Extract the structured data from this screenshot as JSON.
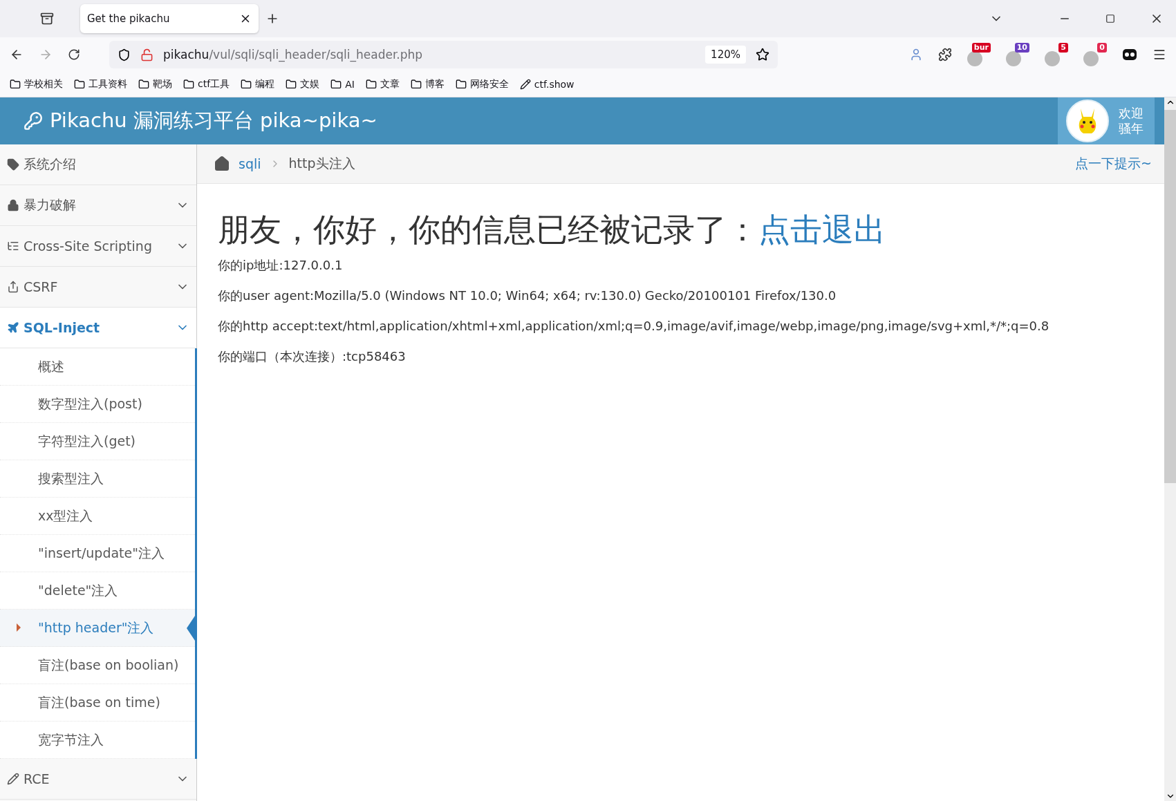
{
  "browser": {
    "tabs": [
      {
        "title": "Get the pikachu",
        "selected": true
      }
    ],
    "url": {
      "host": "pikachu",
      "path": "/vul/sqli/sqli_header/sqli_header.php"
    },
    "zoom": "120%",
    "extensions": [
      {
        "kind": "avatar"
      },
      {
        "kind": "puzzle"
      },
      {
        "kind": "badge",
        "badge": "bur",
        "color": "#d70022"
      },
      {
        "kind": "badge",
        "badge": "10",
        "color": "#6a3fc0"
      },
      {
        "kind": "badge",
        "badge": "5",
        "color": "#d70022"
      },
      {
        "kind": "badge",
        "badge": "0",
        "color": "#e22850"
      },
      {
        "kind": "mask"
      }
    ],
    "bookmarks": [
      {
        "label": "学校相关",
        "kind": "folder"
      },
      {
        "label": "工具资料",
        "kind": "folder"
      },
      {
        "label": "靶场",
        "kind": "folder"
      },
      {
        "label": "ctf工具",
        "kind": "folder"
      },
      {
        "label": "编程",
        "kind": "folder"
      },
      {
        "label": "文娱",
        "kind": "folder"
      },
      {
        "label": "AI",
        "kind": "folder"
      },
      {
        "label": "文章",
        "kind": "folder"
      },
      {
        "label": "博客",
        "kind": "folder"
      },
      {
        "label": "网络安全",
        "kind": "folder"
      },
      {
        "label": "ctf.show",
        "kind": "site"
      }
    ]
  },
  "header": {
    "title": "Pikachu 漏洞练习平台 pika~pika~",
    "user": [
      "欢迎",
      "骚年"
    ]
  },
  "sidebar": [
    {
      "label": "系统介绍",
      "kind": "link",
      "selected": false
    },
    {
      "label": "暴力破解",
      "kind": "menu",
      "selected": false
    },
    {
      "label": "Cross-Site Scripting",
      "kind": "menu",
      "selected": false
    },
    {
      "label": "CSRF",
      "kind": "menu",
      "selected": false
    },
    {
      "label": "SQL-Inject",
      "kind": "menu",
      "expanded": true,
      "selected": true,
      "children": [
        {
          "label": "概述",
          "selected": false
        },
        {
          "label": "数字型注入(post)",
          "selected": false
        },
        {
          "label": "字符型注入(get)",
          "selected": false
        },
        {
          "label": "搜索型注入",
          "selected": false
        },
        {
          "label": "xx型注入",
          "selected": false
        },
        {
          "label": "\"insert/update\"注入",
          "selected": false
        },
        {
          "label": "\"delete\"注入",
          "selected": false
        },
        {
          "label": "\"http header\"注入",
          "selected": true
        },
        {
          "label": "盲注(base on boolian)",
          "selected": false
        },
        {
          "label": "盲注(base on time)",
          "selected": false
        },
        {
          "label": "宽字节注入",
          "selected": false
        }
      ]
    },
    {
      "label": "RCE",
      "kind": "menu",
      "selected": false
    }
  ],
  "breadcrumb": {
    "parent": "sqli",
    "current": "http头注入",
    "hint": "点一下提示~"
  },
  "content": {
    "heading": "朋友，你好，你的信息已经被记录了：",
    "logout": "点击退出",
    "lines": [
      "你的ip地址:127.0.0.1",
      "你的user agent:Mozilla/5.0 (Windows NT 10.0; Win64; x64; rv:130.0) Gecko/20100101 Firefox/130.0",
      "你的http accept:text/html,application/xhtml+xml,application/xml;q=0.9,image/avif,image/webp,image/png,image/svg+xml,*/*;q=0.8",
      "你的端口（本次连接）:tcp58463"
    ]
  }
}
